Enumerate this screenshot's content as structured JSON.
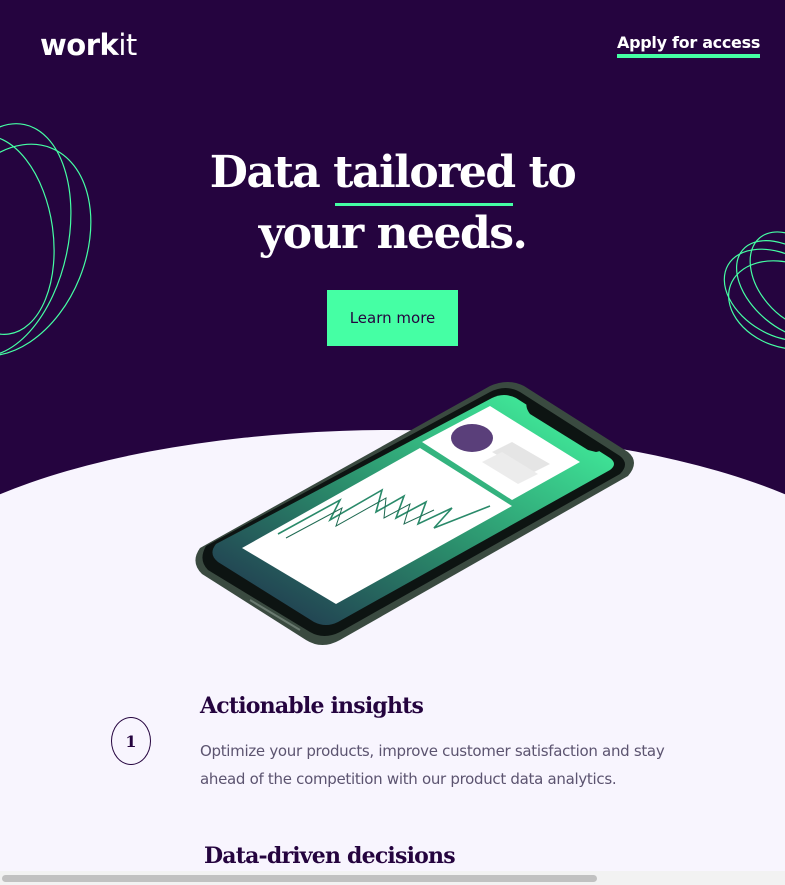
{
  "header": {
    "logo_strong": "work",
    "logo_light": "it",
    "apply_link": "Apply for access"
  },
  "hero": {
    "headline_part1": "Data",
    "headline_highlight": "tailored",
    "headline_part2": "to",
    "headline_line2": "your needs.",
    "cta_label": "Learn more"
  },
  "features": [
    {
      "number": "1",
      "title": "Actionable insights",
      "body": "Optimize your products, improve customer satisfaction and stay ahead of the competition with our product data analytics."
    },
    {
      "title": "Data-driven decisions"
    }
  ],
  "colors": {
    "primary_dark": "#25043f",
    "accent_green": "#45ffa4",
    "background_light": "#f8f5fe"
  },
  "icons": [
    "phone-illustration",
    "decorative-swirl"
  ]
}
